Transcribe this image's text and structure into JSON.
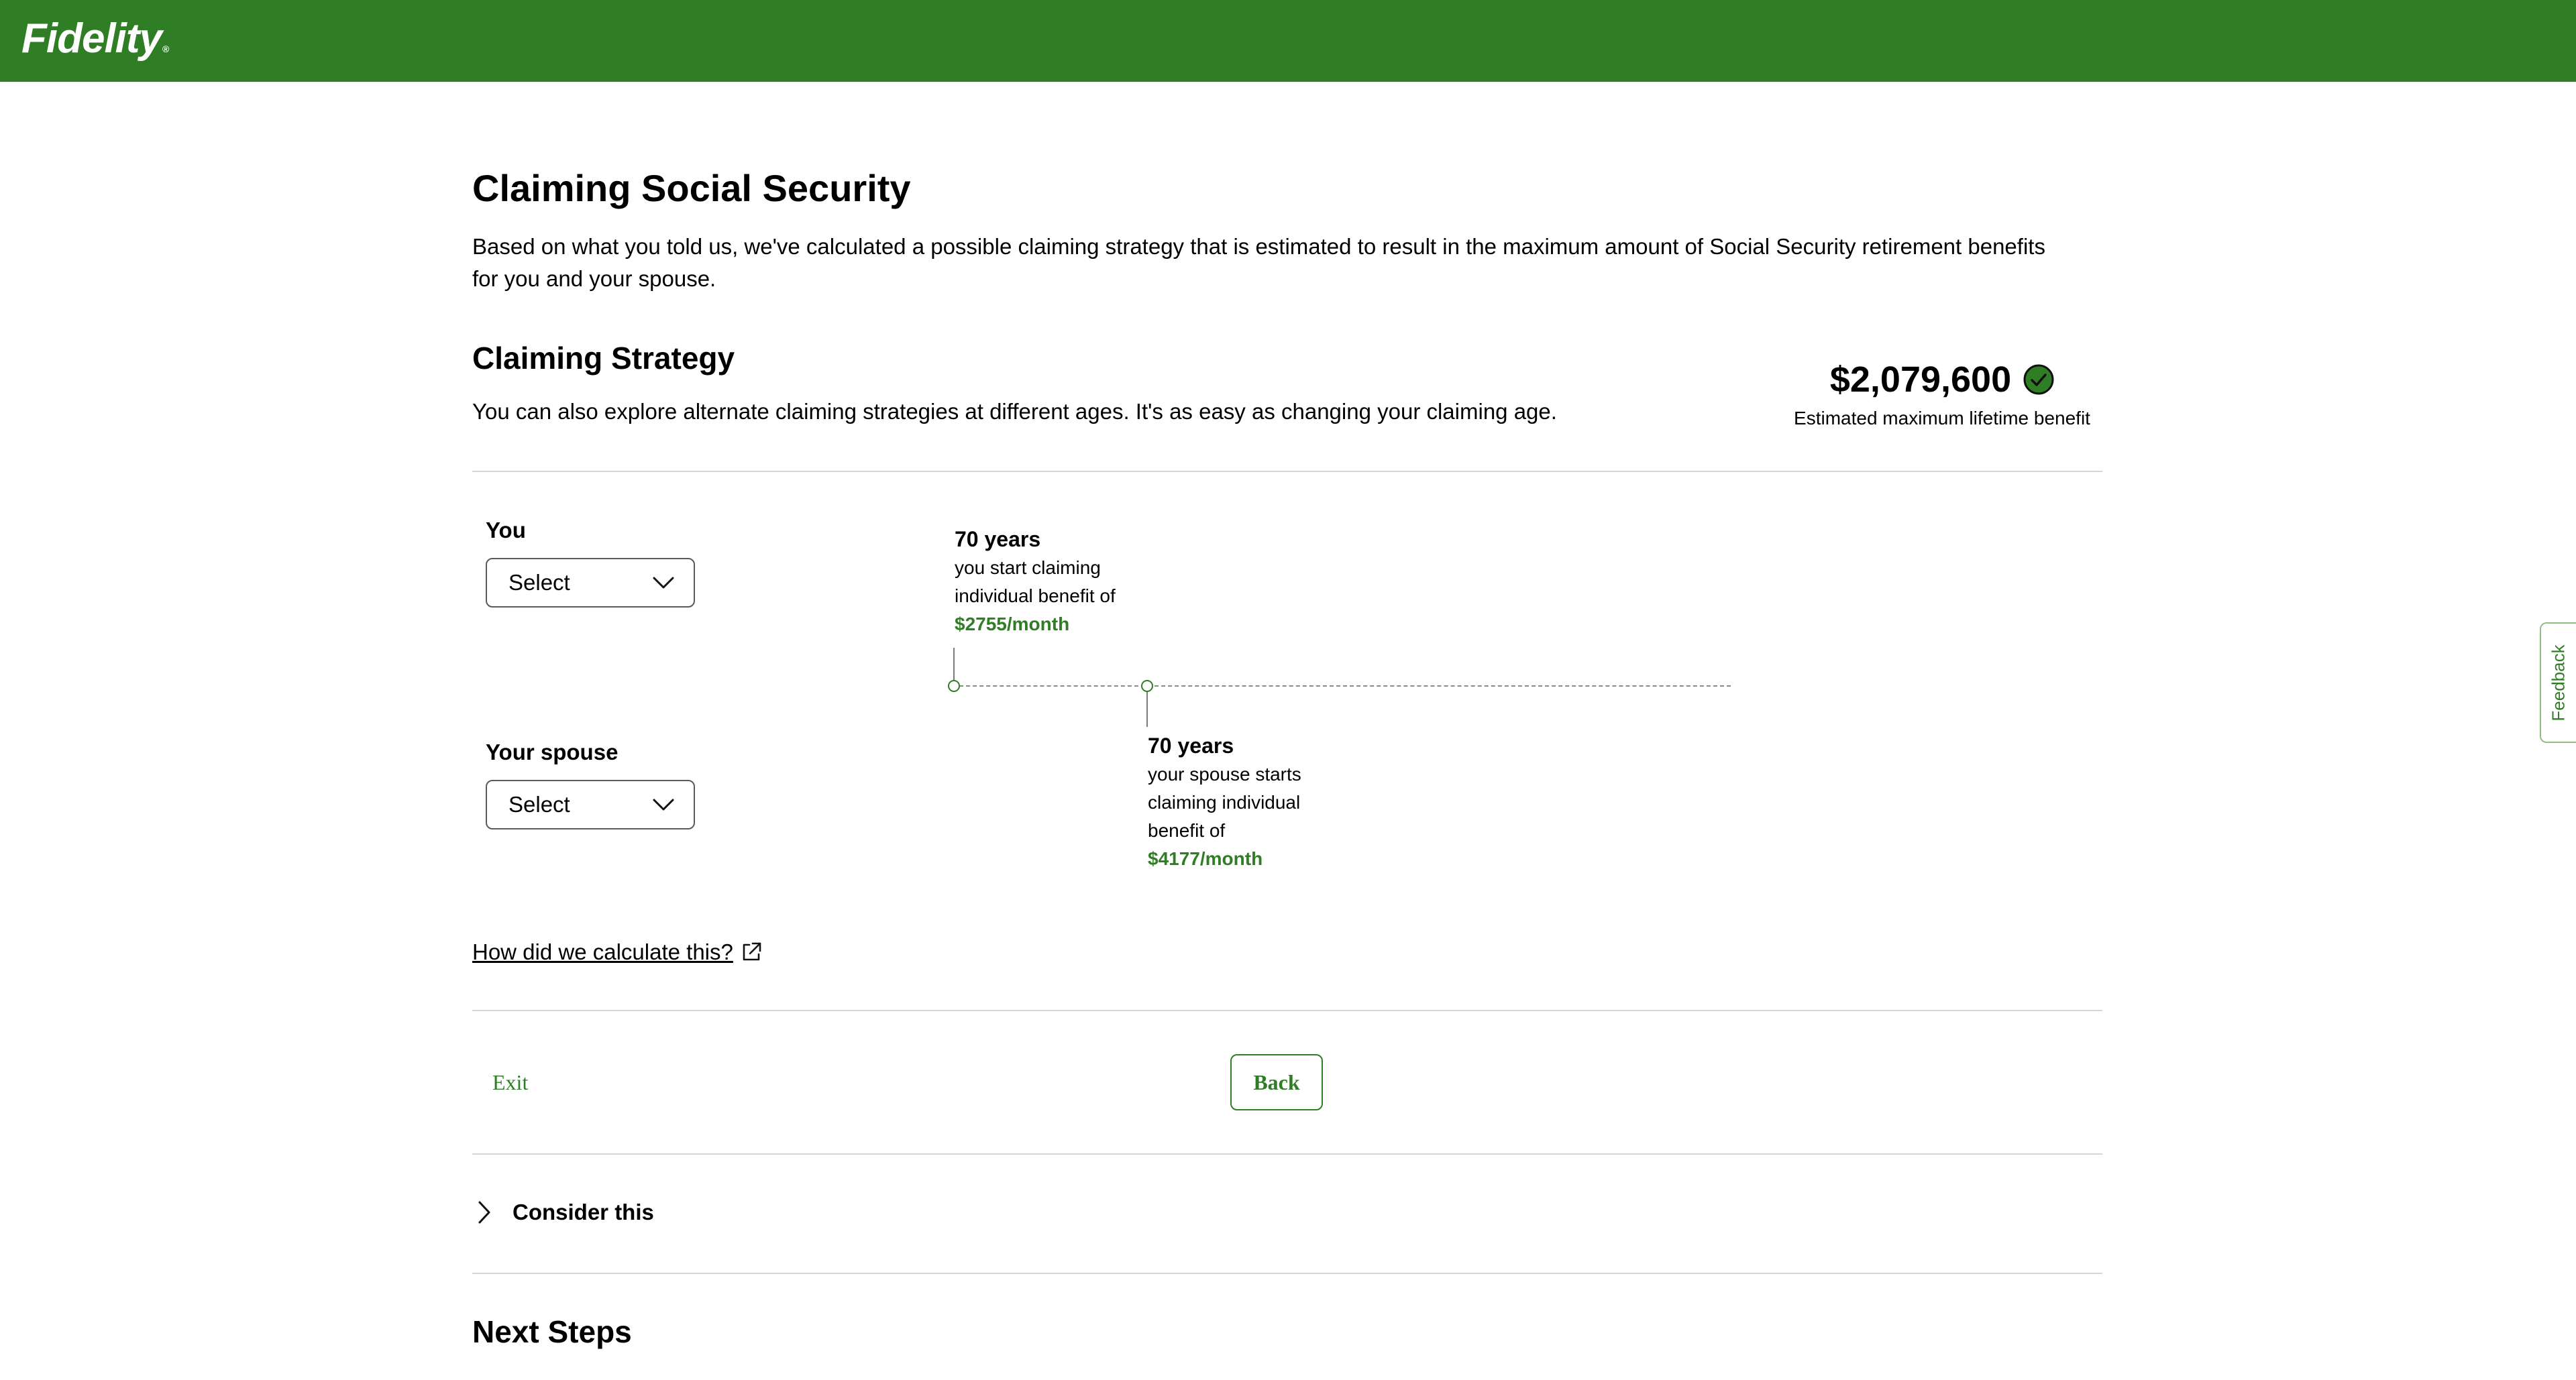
{
  "header": {
    "logo_text": "Fidelity",
    "logo_mark": "®",
    "brand_color": "#2f7d24"
  },
  "page": {
    "title": "Claiming Social Security",
    "intro": "Based on what you told us, we've calculated a possible claiming strategy that is estimated to result in the maximum amount of Social Security retirement benefits for you and your spouse."
  },
  "strategy": {
    "title": "Claiming Strategy",
    "description": "You can also explore alternate claiming strategies at different ages. It's as easy as changing your claiming age.",
    "benefit_amount": "$2,079,600",
    "benefit_label": "Estimated maximum lifetime benefit",
    "benefit_icon": "check-circle-icon"
  },
  "you": {
    "label": "You",
    "select_value": "Select"
  },
  "spouse": {
    "label": "Your spouse",
    "select_value": "Select"
  },
  "timeline": {
    "you": {
      "years": "70 years",
      "line1": "you start claiming",
      "line2": "individual benefit of",
      "amount": "$2755/month"
    },
    "spouse": {
      "years": "70 years",
      "line1": "your spouse starts",
      "line2": "claiming individual",
      "line3": "benefit of",
      "amount": "$4177/month"
    }
  },
  "links": {
    "calc": "How did we calculate this?",
    "exit": "Exit"
  },
  "buttons": {
    "back": "Back"
  },
  "consider": {
    "label": "Consider this"
  },
  "next_steps": {
    "title": "Next Steps"
  },
  "feedback": {
    "label": "Feedback"
  }
}
